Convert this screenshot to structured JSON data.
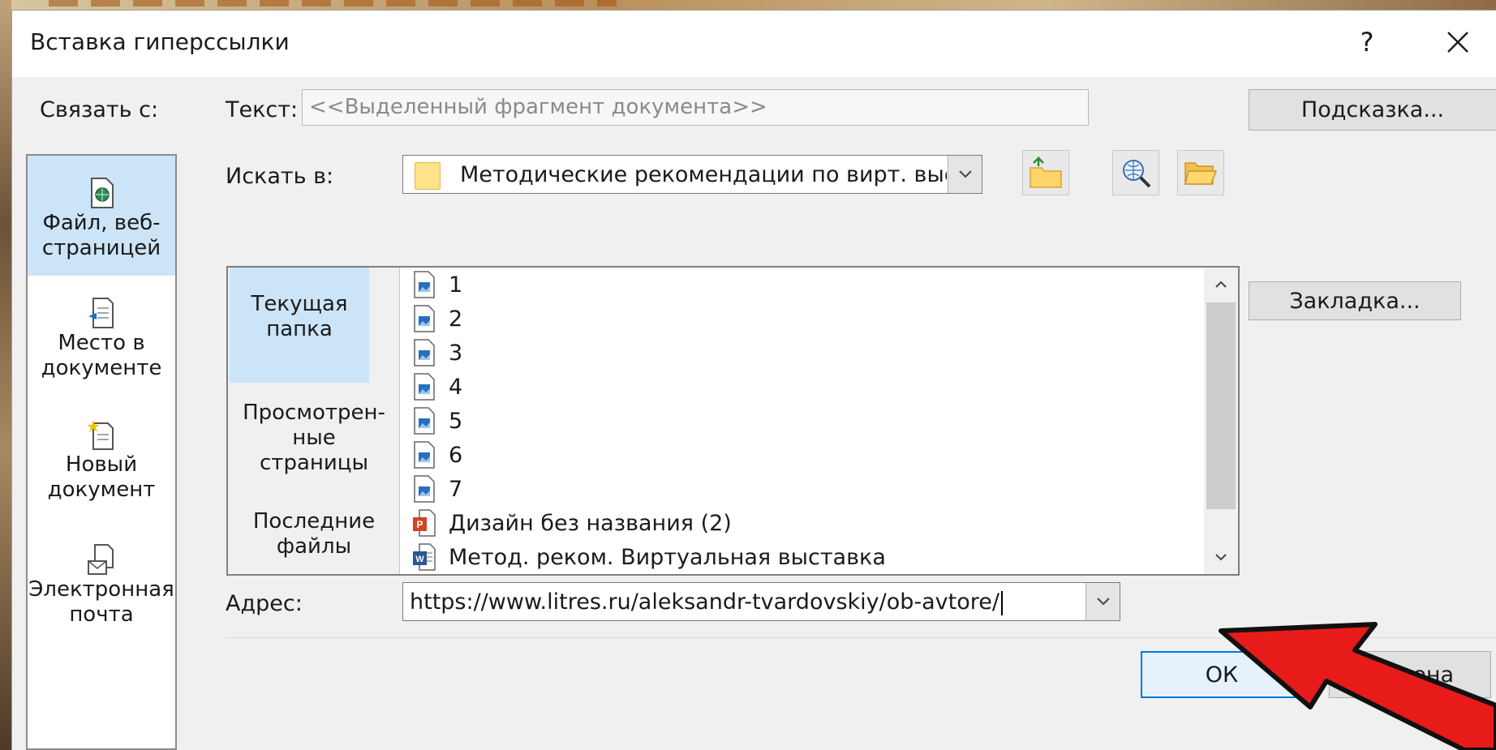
{
  "dialog": {
    "title": "Вставка гиперссылки",
    "help_label": "?",
    "close_icon": "close-icon"
  },
  "link_to": {
    "label": "Связать с:",
    "items": [
      {
        "line1": "Файл, веб-",
        "line2": "страницей",
        "line3": "",
        "icon": "web-page-icon",
        "selected": true
      },
      {
        "line1": "Место в",
        "line2": "документе",
        "line3": "",
        "icon": "document-place-icon",
        "selected": false
      },
      {
        "line1": "Новый",
        "line2": "документ",
        "line3": "",
        "icon": "new-document-icon",
        "selected": false
      },
      {
        "line1": "Электронная",
        "line2": "почта",
        "line3": "",
        "icon": "email-icon",
        "selected": false
      }
    ]
  },
  "text_field": {
    "label": "Текст:",
    "value": "<<Выделенный фрагмент документа>>"
  },
  "screentip_button": "Подсказка...",
  "look_in": {
    "label": "Искать в:",
    "value": "Методические рекомендации по вирт. выставке"
  },
  "places": [
    {
      "line1": "Текущая",
      "line2": "папка",
      "line3": "",
      "selected": true
    },
    {
      "line1": "Просмотрен-",
      "line2": "ные",
      "line3": "страницы",
      "selected": false
    },
    {
      "line1": "Последние",
      "line2": "файлы",
      "line3": "",
      "selected": false
    }
  ],
  "files": [
    {
      "name": "1",
      "type": "image"
    },
    {
      "name": "2",
      "type": "image"
    },
    {
      "name": "3",
      "type": "image"
    },
    {
      "name": "4",
      "type": "image"
    },
    {
      "name": "5",
      "type": "image"
    },
    {
      "name": "6",
      "type": "image"
    },
    {
      "name": "7",
      "type": "image"
    },
    {
      "name": "Дизайн без названия (2)",
      "type": "powerpoint"
    },
    {
      "name": "Метод. реком. Виртуальная выставка",
      "type": "word"
    }
  ],
  "bookmark_button": "Закладка...",
  "address": {
    "label": "Адрес:",
    "value": "https://www.litres.ru/aleksandr-tvardovskiy/ob-avtore/"
  },
  "ok_button": "ОК",
  "cancel_button": "Отмена",
  "colors": {
    "selection": "#cce4f7",
    "accent_border": "#0078d7",
    "annotation_arrow": "#e81b1b"
  }
}
